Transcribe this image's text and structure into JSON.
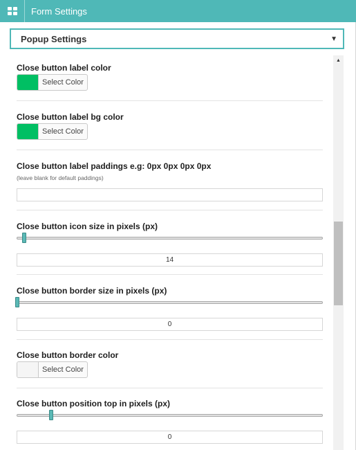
{
  "header": {
    "title": "Form Settings",
    "menu_icon": "grid-icon"
  },
  "section_select": {
    "value": "Popup Settings"
  },
  "fields": {
    "label_color": {
      "label": "Close button label color",
      "swatch_color": "#00bf63",
      "button": "Select Color"
    },
    "label_bg_color": {
      "label": "Close button label bg color",
      "swatch_color": "#00bf63",
      "button": "Select Color"
    },
    "label_paddings": {
      "label": "Close button label paddings e.g: 0px 0px 0px 0px",
      "hint": "(leave blank for default paddings)",
      "value": ""
    },
    "icon_size": {
      "label": "Close button icon size in pixels (px)",
      "value": "14"
    },
    "border_size": {
      "label": "Close button border size in pixels (px)",
      "value": "0"
    },
    "border_color": {
      "label": "Close button border color",
      "swatch_color": "#f5f5f5",
      "button": "Select Color"
    },
    "position_top": {
      "label": "Close button position top in pixels (px)",
      "value": "0"
    }
  },
  "colors": {
    "accent": "#4fb8b7"
  }
}
